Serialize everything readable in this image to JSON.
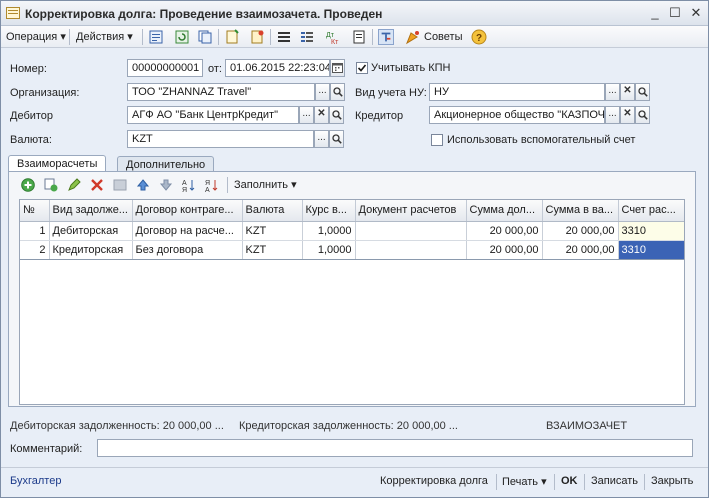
{
  "window": {
    "title": "Корректировка долга: Проведение взаимозачета. Проведен",
    "min_glyph": "_",
    "max_glyph": "☐",
    "close_glyph": "✕"
  },
  "toolbar": {
    "operation": "Операция",
    "actions": "Действия",
    "tips": "Советы",
    "dropdown_glyph": "▾"
  },
  "form": {
    "number_label": "Номер:",
    "number_value": "00000000001",
    "from_label": "от:",
    "date_value": "01.06.2015 22:23:04",
    "kpn_checkbox_checked": true,
    "kpn_label": "Учитывать КПН",
    "org_label": "Организация:",
    "org_value": "ТОО  \"ZHANNAZ Travel\"",
    "nu_label": "Вид учета НУ:",
    "nu_value": "НУ",
    "debtor_label": "Дебитор",
    "debtor_value": "АГФ АО  \"Банк ЦентрКредит\"",
    "creditor_label": "Кредитор",
    "creditor_value": "Акционерное общество \"КАЗПОЧ",
    "currency_label": "Валюта:",
    "currency_value": "KZT",
    "aux_checkbox_checked": false,
    "aux_label": "Использовать вспомогательный счет",
    "ellipsis_glyph": "...",
    "clear_glyph": "✕",
    "search_glyph": "🔍"
  },
  "tabs": [
    {
      "label": "Взаиморасчеты",
      "active": true
    },
    {
      "label": "Дополнительно",
      "active": false
    }
  ],
  "gridbar": {
    "fill_label": "Заполнить"
  },
  "table": {
    "columns": [
      "№",
      "Вид задолже...",
      "Договор контраге...",
      "Валюта",
      "Курс в...",
      "Документ расчетов",
      "Сумма  дол...",
      "Сумма в ва...",
      "Счет рас..."
    ],
    "rows": [
      [
        "1",
        "Дебиторская",
        "Договор на расче...",
        "KZT",
        "1,0000",
        "",
        "20 000,00",
        "20 000,00",
        "3310"
      ],
      [
        "2",
        "Кредиторская",
        "Без договора",
        "KZT",
        "1,0000",
        "",
        "20 000,00",
        "20 000,00",
        "3310"
      ]
    ]
  },
  "status": {
    "debit": "Дебиторская задолженность: 20 000,00 ...",
    "credit": "Кредиторская задолженность: 20 000,00 ...",
    "mode": "ВЗАИМОЗАЧЕТ"
  },
  "comment": {
    "label": "Комментарий:",
    "value": ""
  },
  "bottom": {
    "user": "Бухгалтер",
    "correction": "Корректировка долга",
    "print": "Печать",
    "ok": "OK",
    "save": "Записать",
    "close": "Закрыть"
  }
}
